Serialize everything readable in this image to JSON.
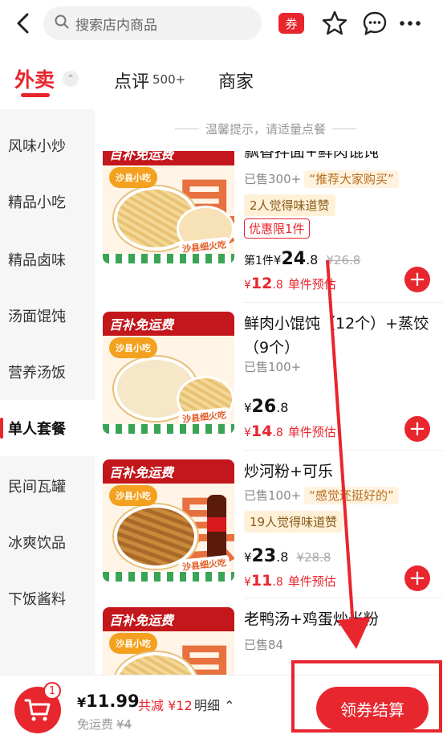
{
  "header": {
    "search_placeholder": "搜索店内商品",
    "coupon_label": "券"
  },
  "tabs": {
    "waimai": "外卖",
    "dianping": "点评",
    "dianping_count": "500+",
    "shangjia": "商家"
  },
  "sidebar": {
    "items": [
      {
        "label": "风味小炒"
      },
      {
        "label": "精品小吃"
      },
      {
        "label": "精品卤味"
      },
      {
        "label": "汤面馄饨"
      },
      {
        "label": "营养汤饭"
      },
      {
        "label": "单人套餐"
      },
      {
        "label": "民间瓦罐"
      },
      {
        "label": "冰爽饮品"
      },
      {
        "label": "下饭酱料"
      }
    ],
    "active_index": 5
  },
  "tip": "温馨提示，请适量点餐",
  "products": [
    {
      "name": "飘香拌面+鲜肉馄饨",
      "banner": "百补免运费",
      "brand_logo": "沙县小吃",
      "stamp": "沙县细火吃",
      "big_char": "县",
      "sold": "已售300+",
      "quote": "“推荐大家购买”",
      "praise": "2人觉得味道赞",
      "limit": "优惠限1件",
      "price_prefix": "第1件",
      "price_currency": "¥",
      "price_int": "24",
      "price_dec": ".8",
      "price_orig": "¥26.8",
      "est_currency": "¥",
      "est_int": "12",
      "est_dec": ".8",
      "est_label": "单件预估"
    },
    {
      "name": "鲜肉小馄饨（12个）+蒸饺（9个）",
      "banner": "百补免运费",
      "brand_logo": "沙县小吃",
      "stamp": "沙县细火吃",
      "sold": "已售100+",
      "price_currency": "¥",
      "price_int": "26",
      "price_dec": ".8",
      "est_currency": "¥",
      "est_int": "14",
      "est_dec": ".8",
      "est_label": "单件预估"
    },
    {
      "name": "炒河粉+可乐",
      "banner": "百补免运费",
      "brand_logo": "沙县小吃",
      "stamp": "沙县细火吃",
      "big_char": "县",
      "sold": "已售100+",
      "quote": "“感觉还挺好的”",
      "praise": "19人觉得味道赞",
      "price_currency": "¥",
      "price_int": "23",
      "price_dec": ".8",
      "price_orig": "¥28.8",
      "est_currency": "¥",
      "est_int": "11",
      "est_dec": ".8",
      "est_label": "单件预估"
    },
    {
      "name": "老鸭汤+鸡蛋炒米粉",
      "banner": "百补免运费",
      "brand_logo": "沙县小吃",
      "big_char": "县",
      "sold": "已售84"
    }
  ],
  "cart": {
    "count": "1",
    "currency": "¥",
    "total": "11.99",
    "saved": "共减 ¥12",
    "detail": "明细",
    "delivery_label": "免运费",
    "delivery_orig": "¥4",
    "checkout_label": "领券结算"
  },
  "colors": {
    "accent": "#e8262e",
    "sidebar_bg": "#f6f6f6"
  }
}
